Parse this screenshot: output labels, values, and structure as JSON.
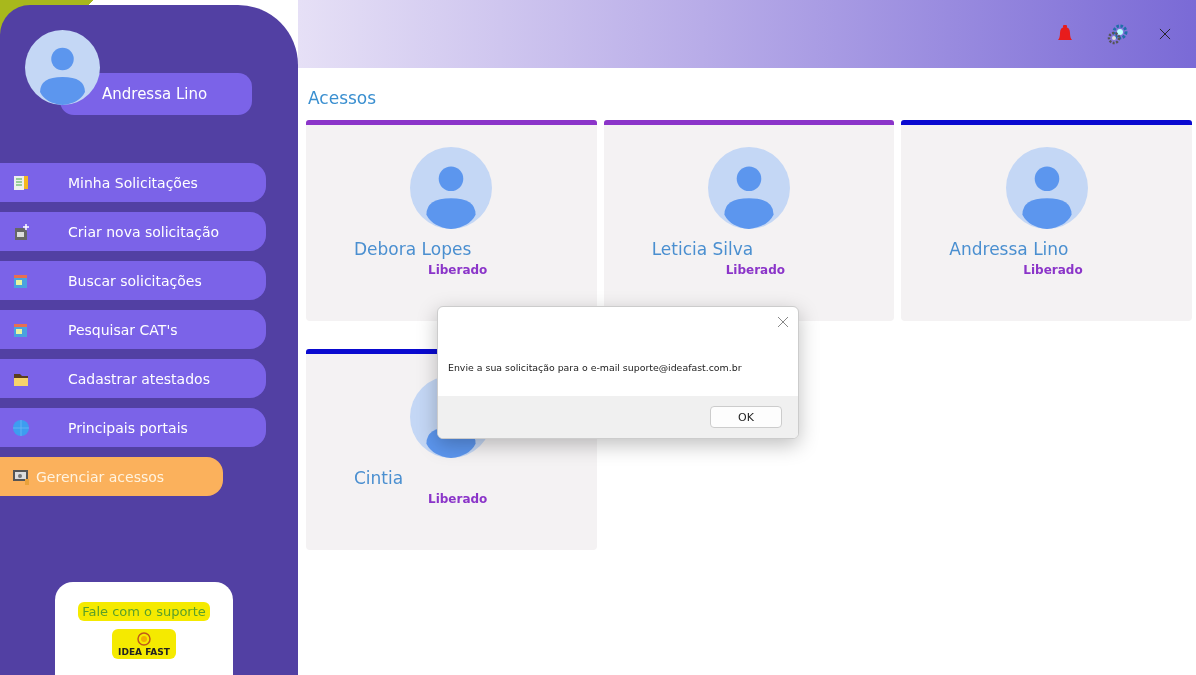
{
  "sidebar": {
    "user": {
      "name": "Andressa Lino"
    },
    "menu": [
      {
        "label": "Minha Solicitações",
        "selected": false
      },
      {
        "label": "Criar nova solicitação",
        "selected": false
      },
      {
        "label": "Buscar solicitações",
        "selected": false
      },
      {
        "label": "Pesquisar CAT's",
        "selected": false
      },
      {
        "label": "Cadastrar atestados",
        "selected": false
      },
      {
        "label": "Principais portais",
        "selected": false
      },
      {
        "label": "Gerenciar acessos",
        "selected": true
      }
    ],
    "support": {
      "label": "Fale com o suporte",
      "logo_text": "IDEA FAST"
    }
  },
  "page": {
    "title": "Acessos",
    "cards": [
      {
        "name": "Debora Lopes",
        "status": "Liberado",
        "color": "#8b35c9"
      },
      {
        "name": "Leticia Silva",
        "status": "Liberado",
        "color": "#8b35c9"
      },
      {
        "name": "Andressa Lino",
        "status": "Liberado",
        "color": "#0a0ad0"
      },
      {
        "name": "Cintia",
        "status": "Liberado",
        "color": "#0a0ad0"
      }
    ]
  },
  "dialog": {
    "message": "Envie a sua solicitação para o e-mail suporte@ideafast.com.br",
    "button": "OK"
  }
}
